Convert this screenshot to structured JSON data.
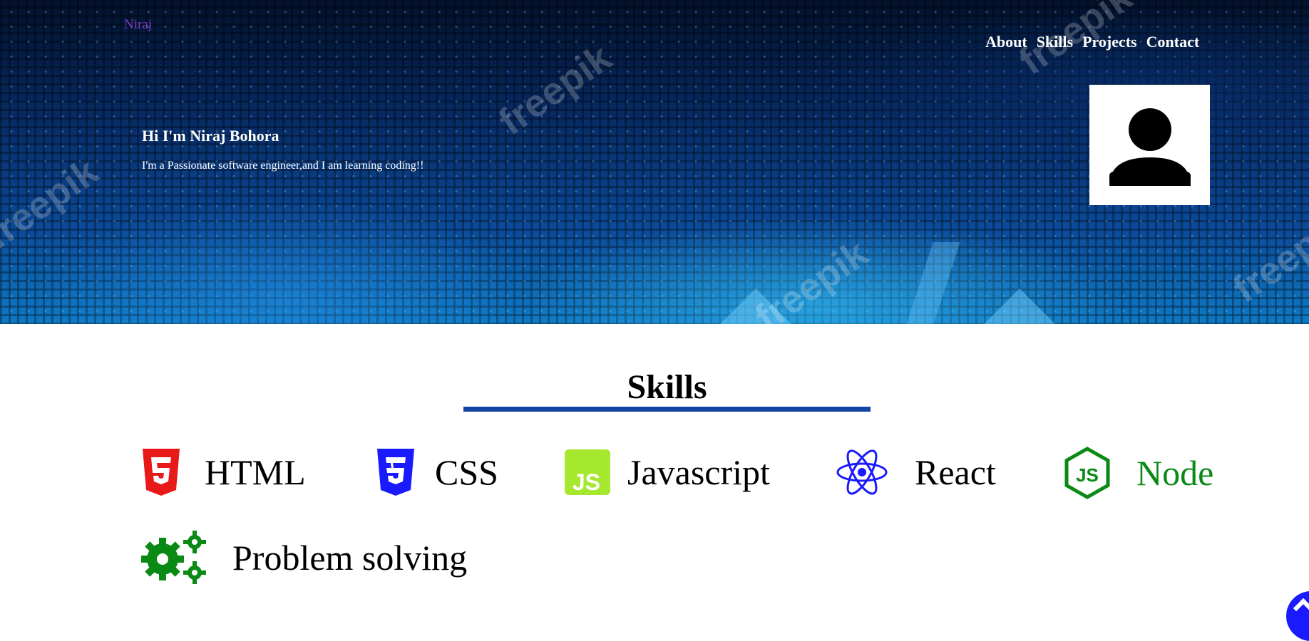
{
  "brand": "Niraj",
  "nav": [
    "About",
    "Skills",
    "Projects",
    "Contact"
  ],
  "hero": {
    "title": "Hi I'm Niraj Bohora",
    "subtitle": "I'm a Passionate software engineer,and I am learning coding!!",
    "watermark": "freepik"
  },
  "avatar_icon": "user-avatar-icon",
  "skills": {
    "title": "Skills",
    "items": [
      {
        "label": "HTML",
        "icon": "html5-icon",
        "color": "#e81919"
      },
      {
        "label": "CSS",
        "icon": "css3-icon",
        "color": "#1a1aff"
      },
      {
        "label": "Javascript",
        "icon": "javascript-icon",
        "color": "#a6e82e"
      },
      {
        "label": "React",
        "icon": "react-icon",
        "color": "#1a1aff"
      },
      {
        "label": "Node",
        "icon": "nodejs-icon",
        "color": "#0a8a14"
      },
      {
        "label": "Problem solving",
        "icon": "gears-icon",
        "color": "#0a8a14"
      }
    ]
  },
  "colors": {
    "underline": "#1146a3",
    "brand": "#7a3cc2",
    "scroll_button": "#1a1aff"
  },
  "scroll_button_icon": "chevron-up-icon"
}
